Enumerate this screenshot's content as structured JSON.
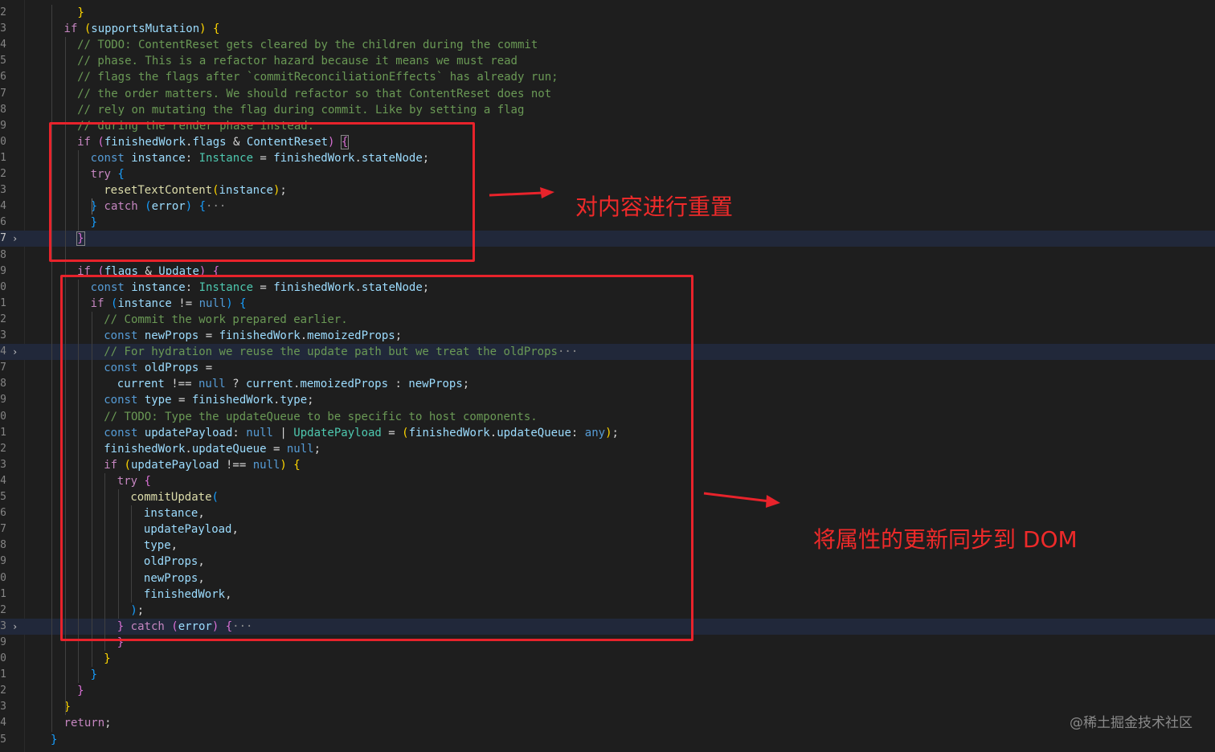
{
  "annotations": {
    "note1": "对内容进行重置",
    "note2": "将属性的更新同步到 DOM",
    "watermark": "@稀土掘金技术社区"
  },
  "colors": {
    "annotation_red": "#e8232b",
    "background": "#1e1e1e",
    "keyword": "#569cd6",
    "control": "#c586c0",
    "variable": "#9cdcfe",
    "function": "#dcdcaa",
    "type": "#4ec9b0",
    "comment": "#6a9955"
  },
  "icons": {
    "fold_chevron": "chevron-right-icon",
    "arrow": "arrow-right-icon"
  },
  "lines": [
    {
      "ln": "2",
      "tokens": [
        [
          "p",
          "  "
        ],
        [
          "b1",
          "}"
        ]
      ]
    },
    {
      "ln": "3",
      "tokens": [
        [
          "ctl",
          "if"
        ],
        [
          "p",
          " "
        ],
        [
          "b1",
          "("
        ],
        [
          "v",
          "supportsMutation"
        ],
        [
          "b1",
          ")"
        ],
        [
          "p",
          " "
        ],
        [
          "b1",
          "{"
        ]
      ]
    },
    {
      "ln": "4",
      "tokens": [
        [
          "c",
          "// TODO: ContentReset gets cleared by the children during the commit"
        ]
      ]
    },
    {
      "ln": "5",
      "tokens": [
        [
          "c",
          "// phase. This is a refactor hazard because it means we must read"
        ]
      ]
    },
    {
      "ln": "6",
      "tokens": [
        [
          "c",
          "// flags the flags after `commitReconciliationEffects` has already run;"
        ]
      ]
    },
    {
      "ln": "7",
      "tokens": [
        [
          "c",
          "// the order matters. We should refactor so that ContentReset does not"
        ]
      ]
    },
    {
      "ln": "8",
      "tokens": [
        [
          "c",
          "// rely on mutating the flag during commit. Like by setting a flag"
        ]
      ]
    },
    {
      "ln": "9",
      "tokens": [
        [
          "c",
          "// during the render phase instead."
        ]
      ]
    },
    {
      "ln": "0",
      "tokens": [
        [
          "ctl",
          "if"
        ],
        [
          "p",
          " "
        ],
        [
          "b2",
          "("
        ],
        [
          "v",
          "finishedWork"
        ],
        [
          "p",
          "."
        ],
        [
          "v",
          "flags"
        ],
        [
          "p",
          " & "
        ],
        [
          "v",
          "ContentReset"
        ],
        [
          "b2",
          ")"
        ],
        [
          "p",
          " "
        ],
        [
          "b2",
          "{"
        ]
      ]
    },
    {
      "ln": "1",
      "tokens": [
        [
          "kw",
          "const"
        ],
        [
          "p",
          " "
        ],
        [
          "v",
          "instance"
        ],
        [
          "p",
          ": "
        ],
        [
          "t",
          "Instance"
        ],
        [
          "p",
          " = "
        ],
        [
          "v",
          "finishedWork"
        ],
        [
          "p",
          "."
        ],
        [
          "v",
          "stateNode"
        ],
        [
          "p",
          ";"
        ]
      ]
    },
    {
      "ln": "2",
      "tokens": [
        [
          "ctl",
          "try"
        ],
        [
          "p",
          " "
        ],
        [
          "b3",
          "{"
        ]
      ]
    },
    {
      "ln": "3",
      "tokens": [
        [
          "fn",
          "resetTextContent"
        ],
        [
          "b1",
          "("
        ],
        [
          "v",
          "instance"
        ],
        [
          "b1",
          ")"
        ],
        [
          "p",
          ";"
        ]
      ]
    },
    {
      "ln": "4",
      "tokens": [
        [
          "b3",
          "}"
        ],
        [
          "p",
          " "
        ],
        [
          "ctl",
          "catch"
        ],
        [
          "p",
          " "
        ],
        [
          "b3",
          "("
        ],
        [
          "v",
          "error"
        ],
        [
          "b3",
          ")"
        ],
        [
          "p",
          " "
        ],
        [
          "b3",
          "{"
        ],
        [
          "dots",
          "···"
        ]
      ]
    },
    {
      "ln": "6",
      "tokens": [
        [
          "b3",
          "}"
        ]
      ]
    },
    {
      "ln": "7",
      "tokens": [
        [
          "b2",
          "}"
        ]
      ]
    },
    {
      "ln": "8",
      "tokens": []
    },
    {
      "ln": "9",
      "tokens": [
        [
          "ctl",
          "if"
        ],
        [
          "p",
          " "
        ],
        [
          "b2",
          "("
        ],
        [
          "v",
          "flags"
        ],
        [
          "p",
          " & "
        ],
        [
          "v",
          "Update"
        ],
        [
          "b2",
          ")"
        ],
        [
          "p",
          " "
        ],
        [
          "b2",
          "{"
        ]
      ]
    },
    {
      "ln": "0",
      "tokens": [
        [
          "kw",
          "const"
        ],
        [
          "p",
          " "
        ],
        [
          "v",
          "instance"
        ],
        [
          "p",
          ": "
        ],
        [
          "t",
          "Instance"
        ],
        [
          "p",
          " = "
        ],
        [
          "v",
          "finishedWork"
        ],
        [
          "p",
          "."
        ],
        [
          "v",
          "stateNode"
        ],
        [
          "p",
          ";"
        ]
      ]
    },
    {
      "ln": "1",
      "tokens": [
        [
          "ctl",
          "if"
        ],
        [
          "p",
          " "
        ],
        [
          "b3",
          "("
        ],
        [
          "v",
          "instance"
        ],
        [
          "p",
          " != "
        ],
        [
          "kw",
          "null"
        ],
        [
          "b3",
          ")"
        ],
        [
          "p",
          " "
        ],
        [
          "b3",
          "{"
        ]
      ]
    },
    {
      "ln": "2",
      "tokens": [
        [
          "c",
          "// Commit the work prepared earlier."
        ]
      ]
    },
    {
      "ln": "3",
      "tokens": [
        [
          "kw",
          "const"
        ],
        [
          "p",
          " "
        ],
        [
          "v",
          "newProps"
        ],
        [
          "p",
          " = "
        ],
        [
          "v",
          "finishedWork"
        ],
        [
          "p",
          "."
        ],
        [
          "v",
          "memoizedProps"
        ],
        [
          "p",
          ";"
        ]
      ]
    },
    {
      "ln": "4",
      "tokens": [
        [
          "c",
          "// For hydration we reuse the update path but we treat the oldProps"
        ],
        [
          "dots",
          "···"
        ]
      ]
    },
    {
      "ln": "7",
      "tokens": [
        [
          "kw",
          "const"
        ],
        [
          "p",
          " "
        ],
        [
          "v",
          "oldProps"
        ],
        [
          "p",
          " ="
        ]
      ]
    },
    {
      "ln": "8",
      "tokens": [
        [
          "v",
          "current"
        ],
        [
          "p",
          " !== "
        ],
        [
          "kw",
          "null"
        ],
        [
          "p",
          " ? "
        ],
        [
          "v",
          "current"
        ],
        [
          "p",
          "."
        ],
        [
          "v",
          "memoizedProps"
        ],
        [
          "p",
          " : "
        ],
        [
          "v",
          "newProps"
        ],
        [
          "p",
          ";"
        ]
      ]
    },
    {
      "ln": "9",
      "tokens": [
        [
          "kw",
          "const"
        ],
        [
          "p",
          " "
        ],
        [
          "v",
          "type"
        ],
        [
          "p",
          " = "
        ],
        [
          "v",
          "finishedWork"
        ],
        [
          "p",
          "."
        ],
        [
          "v",
          "type"
        ],
        [
          "p",
          ";"
        ]
      ]
    },
    {
      "ln": "0",
      "tokens": [
        [
          "c",
          "// TODO: Type the updateQueue to be specific to host components."
        ]
      ]
    },
    {
      "ln": "1",
      "tokens": [
        [
          "kw",
          "const"
        ],
        [
          "p",
          " "
        ],
        [
          "v",
          "updatePayload"
        ],
        [
          "p",
          ": "
        ],
        [
          "kw",
          "null"
        ],
        [
          "p",
          " | "
        ],
        [
          "t",
          "UpdatePayload"
        ],
        [
          "p",
          " = "
        ],
        [
          "b1",
          "("
        ],
        [
          "v",
          "finishedWork"
        ],
        [
          "p",
          "."
        ],
        [
          "v",
          "updateQueue"
        ],
        [
          "p",
          ": "
        ],
        [
          "kw",
          "any"
        ],
        [
          "b1",
          ")"
        ],
        [
          "p",
          ";"
        ]
      ]
    },
    {
      "ln": "2",
      "tokens": [
        [
          "v",
          "finishedWork"
        ],
        [
          "p",
          "."
        ],
        [
          "v",
          "updateQueue"
        ],
        [
          "p",
          " = "
        ],
        [
          "kw",
          "null"
        ],
        [
          "p",
          ";"
        ]
      ]
    },
    {
      "ln": "3",
      "tokens": [
        [
          "ctl",
          "if"
        ],
        [
          "p",
          " "
        ],
        [
          "b1",
          "("
        ],
        [
          "v",
          "updatePayload"
        ],
        [
          "p",
          " !== "
        ],
        [
          "kw",
          "null"
        ],
        [
          "b1",
          ")"
        ],
        [
          "p",
          " "
        ],
        [
          "b1",
          "{"
        ]
      ]
    },
    {
      "ln": "4",
      "tokens": [
        [
          "ctl",
          "try"
        ],
        [
          "p",
          " "
        ],
        [
          "b2",
          "{"
        ]
      ]
    },
    {
      "ln": "5",
      "tokens": [
        [
          "fn",
          "commitUpdate"
        ],
        [
          "b3",
          "("
        ]
      ]
    },
    {
      "ln": "6",
      "tokens": [
        [
          "v",
          "instance"
        ],
        [
          "p",
          ","
        ]
      ]
    },
    {
      "ln": "7",
      "tokens": [
        [
          "v",
          "updatePayload"
        ],
        [
          "p",
          ","
        ]
      ]
    },
    {
      "ln": "8",
      "tokens": [
        [
          "v",
          "type"
        ],
        [
          "p",
          ","
        ]
      ]
    },
    {
      "ln": "9",
      "tokens": [
        [
          "v",
          "oldProps"
        ],
        [
          "p",
          ","
        ]
      ]
    },
    {
      "ln": "0",
      "tokens": [
        [
          "v",
          "newProps"
        ],
        [
          "p",
          ","
        ]
      ]
    },
    {
      "ln": "1",
      "tokens": [
        [
          "v",
          "finishedWork"
        ],
        [
          "p",
          ","
        ]
      ]
    },
    {
      "ln": "2",
      "tokens": [
        [
          "b3",
          ")"
        ],
        [
          "p",
          ";"
        ]
      ]
    },
    {
      "ln": "3",
      "tokens": [
        [
          "b2",
          "}"
        ],
        [
          "p",
          " "
        ],
        [
          "ctl",
          "catch"
        ],
        [
          "p",
          " "
        ],
        [
          "b2",
          "("
        ],
        [
          "v",
          "error"
        ],
        [
          "b2",
          ")"
        ],
        [
          "p",
          " "
        ],
        [
          "b2",
          "{"
        ],
        [
          "dots",
          "···"
        ]
      ]
    },
    {
      "ln": "9",
      "tokens": [
        [
          "b2",
          "}"
        ]
      ]
    },
    {
      "ln": "0",
      "tokens": [
        [
          "b1",
          "}"
        ]
      ]
    },
    {
      "ln": "1",
      "tokens": [
        [
          "b3",
          "}"
        ]
      ]
    },
    {
      "ln": "2",
      "tokens": [
        [
          "b2",
          "}"
        ]
      ]
    },
    {
      "ln": "3",
      "tokens": [
        [
          "b1",
          "}"
        ]
      ]
    },
    {
      "ln": "4",
      "tokens": [
        [
          "ctl",
          "return"
        ],
        [
          "p",
          ";"
        ]
      ]
    },
    {
      "ln": "5",
      "tokens": [
        [
          "b3",
          "}"
        ]
      ]
    }
  ]
}
